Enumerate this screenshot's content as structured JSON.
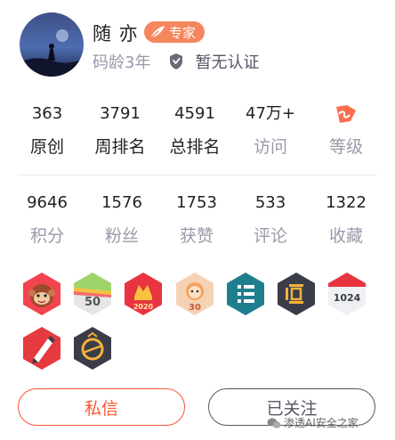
{
  "profile": {
    "name": "随 亦",
    "expert_badge": "专家",
    "code_age": "码龄3年",
    "certification": "暂无认证"
  },
  "stats_row1": [
    {
      "value": "363",
      "label": "原创"
    },
    {
      "value": "3791",
      "label": "周排名"
    },
    {
      "value": "4591",
      "label": "总排名"
    },
    {
      "value": "47万+",
      "label": "访问"
    },
    {
      "value": "",
      "label": "等级"
    }
  ],
  "stats_row2": [
    {
      "value": "9646",
      "label": "积分"
    },
    {
      "value": "1576",
      "label": "粉丝"
    },
    {
      "value": "1753",
      "label": "获赞"
    },
    {
      "value": "533",
      "label": "评论"
    },
    {
      "value": "1322",
      "label": "收藏"
    }
  ],
  "medals": [
    {
      "icon": "monkey-medal-icon"
    },
    {
      "icon": "fifty-days-medal-icon",
      "text": "50"
    },
    {
      "icon": "year-2020-medal-icon",
      "text": "2020"
    },
    {
      "icon": "thirty-days-medal-icon",
      "text": "30"
    },
    {
      "icon": "list-medal-icon"
    },
    {
      "icon": "persistence-medal-icon"
    },
    {
      "icon": "1024-medal-icon",
      "text": "1024"
    },
    {
      "icon": "pen-medal-icon"
    },
    {
      "icon": "gold-ring-medal-icon"
    }
  ],
  "buttons": {
    "message": "私信",
    "follow": "已关注"
  },
  "watermark": "渗透AI安全之家",
  "colors": {
    "accent": "#fc5531",
    "expert_badge": "#f5865d",
    "text_primary": "#222226",
    "text_secondary": "#999aaa"
  }
}
